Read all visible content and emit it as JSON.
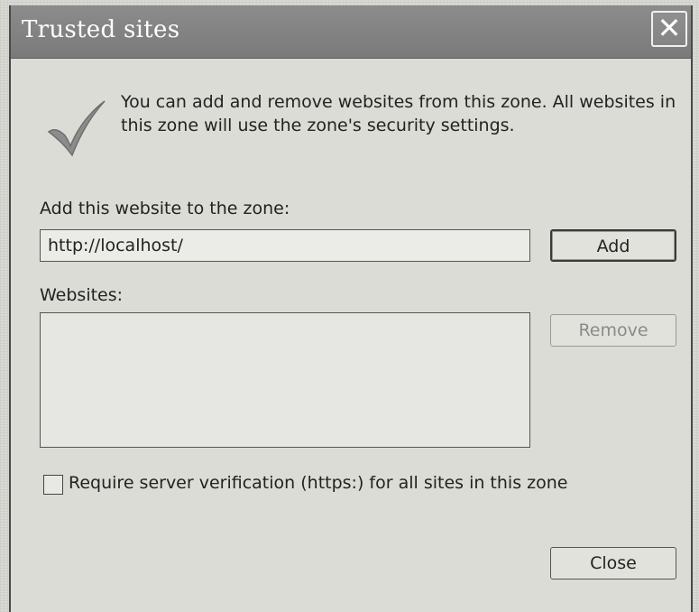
{
  "window": {
    "title": "Trusted sites",
    "close_glyph": "✕"
  },
  "intro": {
    "icon": "checkmark-icon",
    "text": "You can add and remove websites from this zone. All websites in this zone will use the zone's security settings."
  },
  "add_site": {
    "label": "Add this website to the zone:",
    "value": "http://localhost/",
    "button_label": "Add"
  },
  "websites": {
    "label": "Websites:",
    "items": [],
    "remove_label": "Remove"
  },
  "https_requirement": {
    "checked": false,
    "label": "Require server verification (https:) for all sites in this zone"
  },
  "footer": {
    "close_label": "Close"
  },
  "colors": {
    "titlebar": "#808080",
    "dialog_bg": "#dcdcd6",
    "check_mark": "#8c8c8c"
  }
}
